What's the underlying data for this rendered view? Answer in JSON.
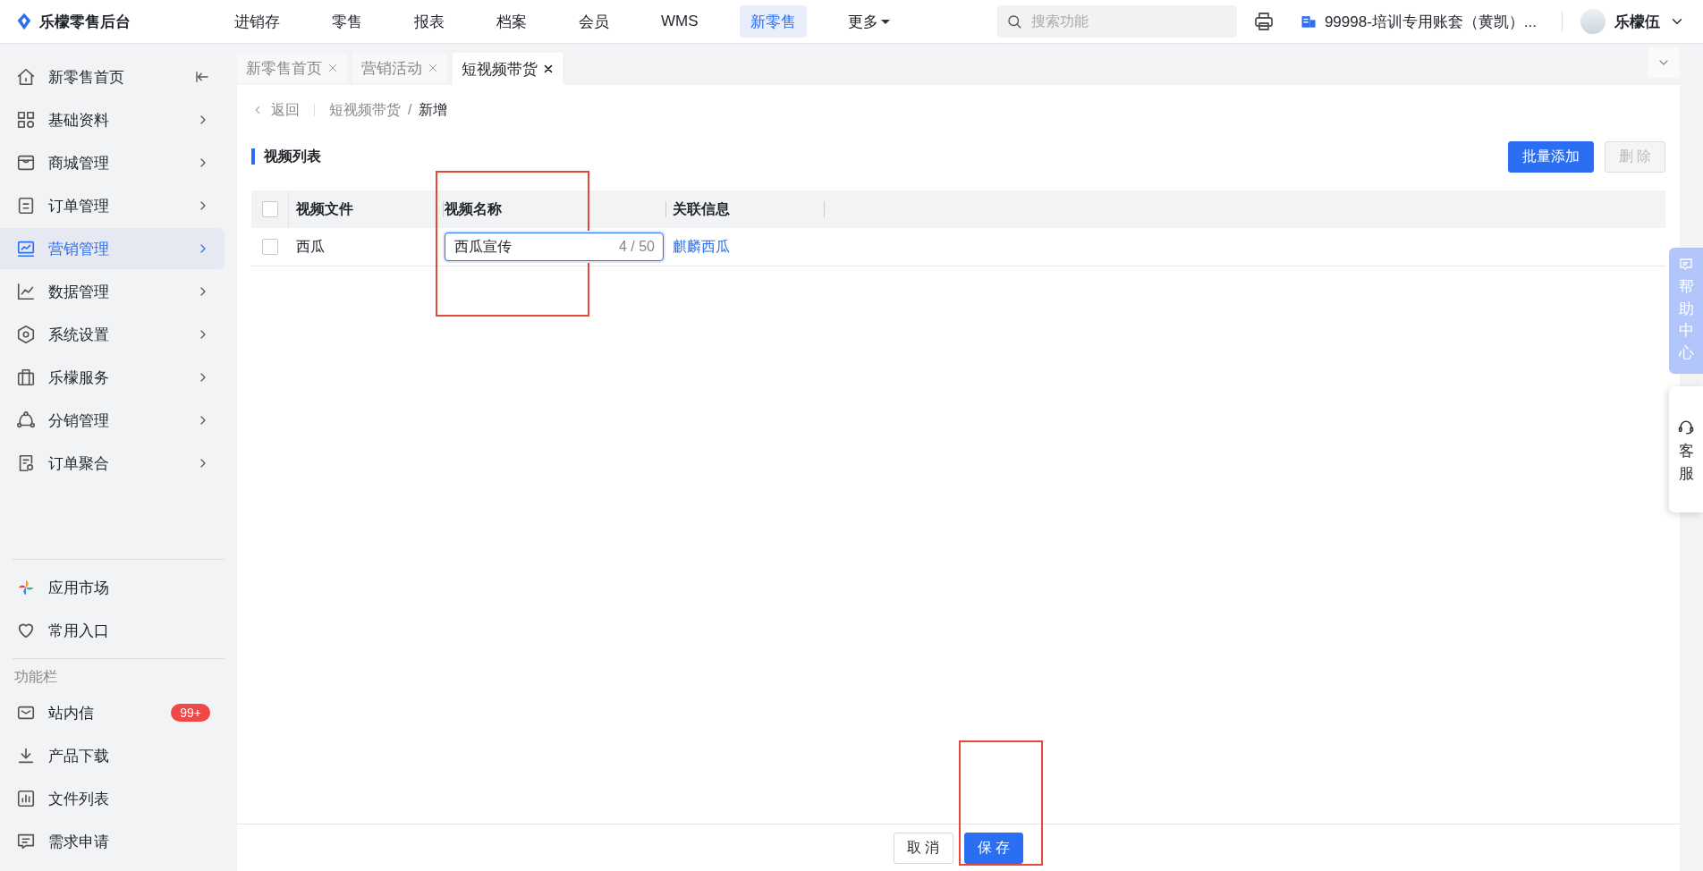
{
  "app": {
    "title": "乐檬零售后台"
  },
  "top_nav": [
    {
      "label": "进销存",
      "selected": false,
      "has_caret": false
    },
    {
      "label": "零售",
      "selected": false,
      "has_caret": false
    },
    {
      "label": "报表",
      "selected": false,
      "has_caret": false
    },
    {
      "label": "档案",
      "selected": false,
      "has_caret": false
    },
    {
      "label": "会员",
      "selected": false,
      "has_caret": false
    },
    {
      "label": "WMS",
      "selected": false,
      "has_caret": false
    },
    {
      "label": "新零售",
      "selected": true,
      "has_caret": false
    },
    {
      "label": "更多",
      "selected": false,
      "has_caret": true
    }
  ],
  "search": {
    "placeholder": "搜索功能"
  },
  "account": {
    "label": "99998-培训专用账套（黄凯）..."
  },
  "user": {
    "name": "乐檬伍"
  },
  "tabs": [
    {
      "label": "新零售首页",
      "selected": false
    },
    {
      "label": "营销活动",
      "selected": false
    },
    {
      "label": "短视频带货",
      "selected": true
    }
  ],
  "sidebar": {
    "menu": [
      {
        "label": "新零售首页",
        "selected": false,
        "kind": "pin"
      },
      {
        "label": "基础资料",
        "selected": false,
        "kind": "submenu"
      },
      {
        "label": "商城管理",
        "selected": false,
        "kind": "submenu"
      },
      {
        "label": "订单管理",
        "selected": false,
        "kind": "submenu"
      },
      {
        "label": "营销管理",
        "selected": true,
        "kind": "submenu"
      },
      {
        "label": "数据管理",
        "selected": false,
        "kind": "submenu"
      },
      {
        "label": "系统设置",
        "selected": false,
        "kind": "submenu"
      },
      {
        "label": "乐檬服务",
        "selected": false,
        "kind": "submenu"
      },
      {
        "label": "分销管理",
        "selected": false,
        "kind": "submenu"
      },
      {
        "label": "订单聚合",
        "selected": false,
        "kind": "submenu"
      }
    ],
    "shortcuts": [
      {
        "label": "应用市场"
      },
      {
        "label": "常用入口"
      }
    ],
    "section_title": "功能栏",
    "tools": [
      {
        "label": "站内信",
        "badge": "99+"
      },
      {
        "label": "产品下载"
      },
      {
        "label": "文件列表"
      },
      {
        "label": "需求申请"
      }
    ]
  },
  "breadcrumb": {
    "back": "返回",
    "separator": "/",
    "path": [
      "短视频带货",
      "新增"
    ]
  },
  "section": {
    "title": "视频列表",
    "buttons": [
      {
        "label": "批量添加",
        "kind": "primary",
        "disabled": false
      },
      {
        "label": "删 除",
        "kind": "default",
        "disabled": true
      }
    ]
  },
  "table": {
    "header_checked": false,
    "columns": [
      {
        "label": "视频文件",
        "highlighted": false
      },
      {
        "label": "视频名称",
        "highlighted": true
      },
      {
        "label": "关联信息",
        "highlighted": false
      }
    ],
    "rows": [
      {
        "checked": false,
        "file": "西瓜",
        "name": "西瓜宣传",
        "count": "4 / 50",
        "link": "麒麟西瓜"
      }
    ]
  },
  "footer": {
    "buttons": [
      {
        "label": "取 消",
        "kind": "default",
        "highlighted": false
      },
      {
        "label": "保 存",
        "kind": "primary",
        "highlighted": true
      }
    ]
  },
  "float": {
    "help": "帮助中心",
    "service": "客服"
  }
}
